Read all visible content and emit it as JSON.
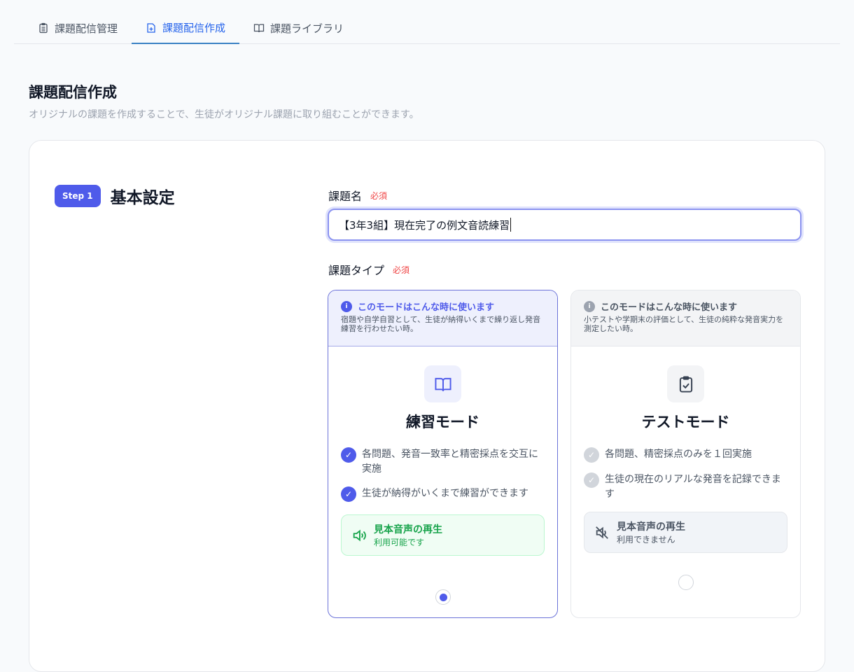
{
  "tabs": [
    {
      "label": "課題配信管理",
      "icon": "clipboard-icon"
    },
    {
      "label": "課題配信作成",
      "icon": "file-plus-icon"
    },
    {
      "label": "課題ライブラリ",
      "icon": "book-open-icon"
    }
  ],
  "page": {
    "title": "課題配信作成",
    "subtitle": "オリジナルの課題を作成することで、生徒がオリジナル課題に取り組むことができます。"
  },
  "step": {
    "badge": "Step 1",
    "title": "基本設定"
  },
  "form": {
    "name_label": "課題名",
    "type_label": "課題タイプ",
    "required": "必須",
    "name_value": "【3年3組】現在完了の例文音読練習"
  },
  "modes": [
    {
      "hint_title": "このモードはこんな時に使います",
      "hint_text": "宿題や自学自習として、生徒が納得いくまで繰り返し発音練習を行わせたい時。",
      "name": "練習モード",
      "features": [
        "各問題、発音一致率と精密採点を交互に実施",
        "生徒が納得がいくまで練習ができます"
      ],
      "audio_title": "見本音声の再生",
      "audio_status": "利用可能です",
      "selected": true
    },
    {
      "hint_title": "このモードはこんな時に使います",
      "hint_text": "小テストや学期末の評価として、生徒の純粋な発音実力を測定したい時。",
      "name": "テストモード",
      "features": [
        "各問題、精密採点のみを１回実施",
        "生徒の現在のリアルな発音を記録できます"
      ],
      "audio_title": "見本音声の再生",
      "audio_status": "利用できません",
      "selected": false
    }
  ],
  "colors": {
    "accent": "#4f5bea",
    "success": "#16a34a"
  }
}
